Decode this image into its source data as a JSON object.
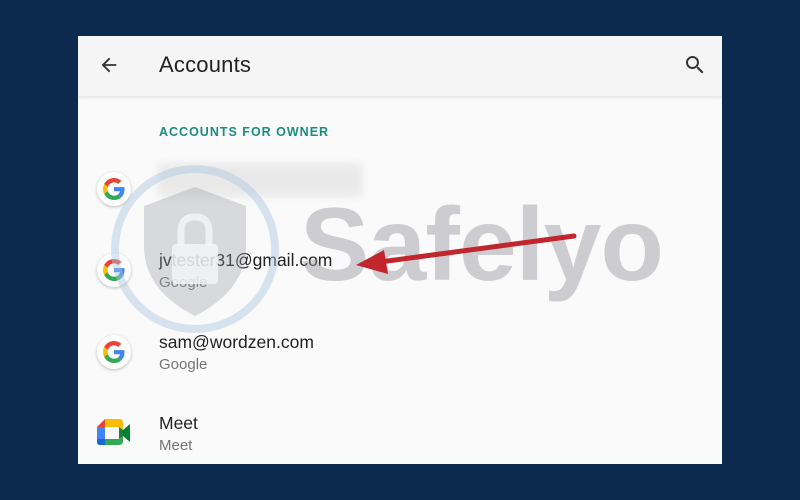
{
  "appbar": {
    "title": "Accounts",
    "back_icon": "arrow-back-icon",
    "search_icon": "search-icon"
  },
  "section": {
    "header": "ACCOUNTS FOR OWNER"
  },
  "accounts": [
    {
      "primary": "",
      "secondary": "",
      "icon": "google-icon",
      "blurred": true
    },
    {
      "primary": "jvtester31@gmail.com",
      "secondary": "Google",
      "icon": "google-icon"
    },
    {
      "primary": "sam@wordzen.com",
      "secondary": "Google",
      "icon": "google-icon"
    },
    {
      "primary": "Meet",
      "secondary": "Meet",
      "icon": "google-meet-icon"
    }
  ],
  "watermark": {
    "text": "Safelyo"
  },
  "annotation": {
    "arrow_color": "#c0262c"
  },
  "colors": {
    "background": "#0c2a4e",
    "accent": "#1b8c81"
  }
}
